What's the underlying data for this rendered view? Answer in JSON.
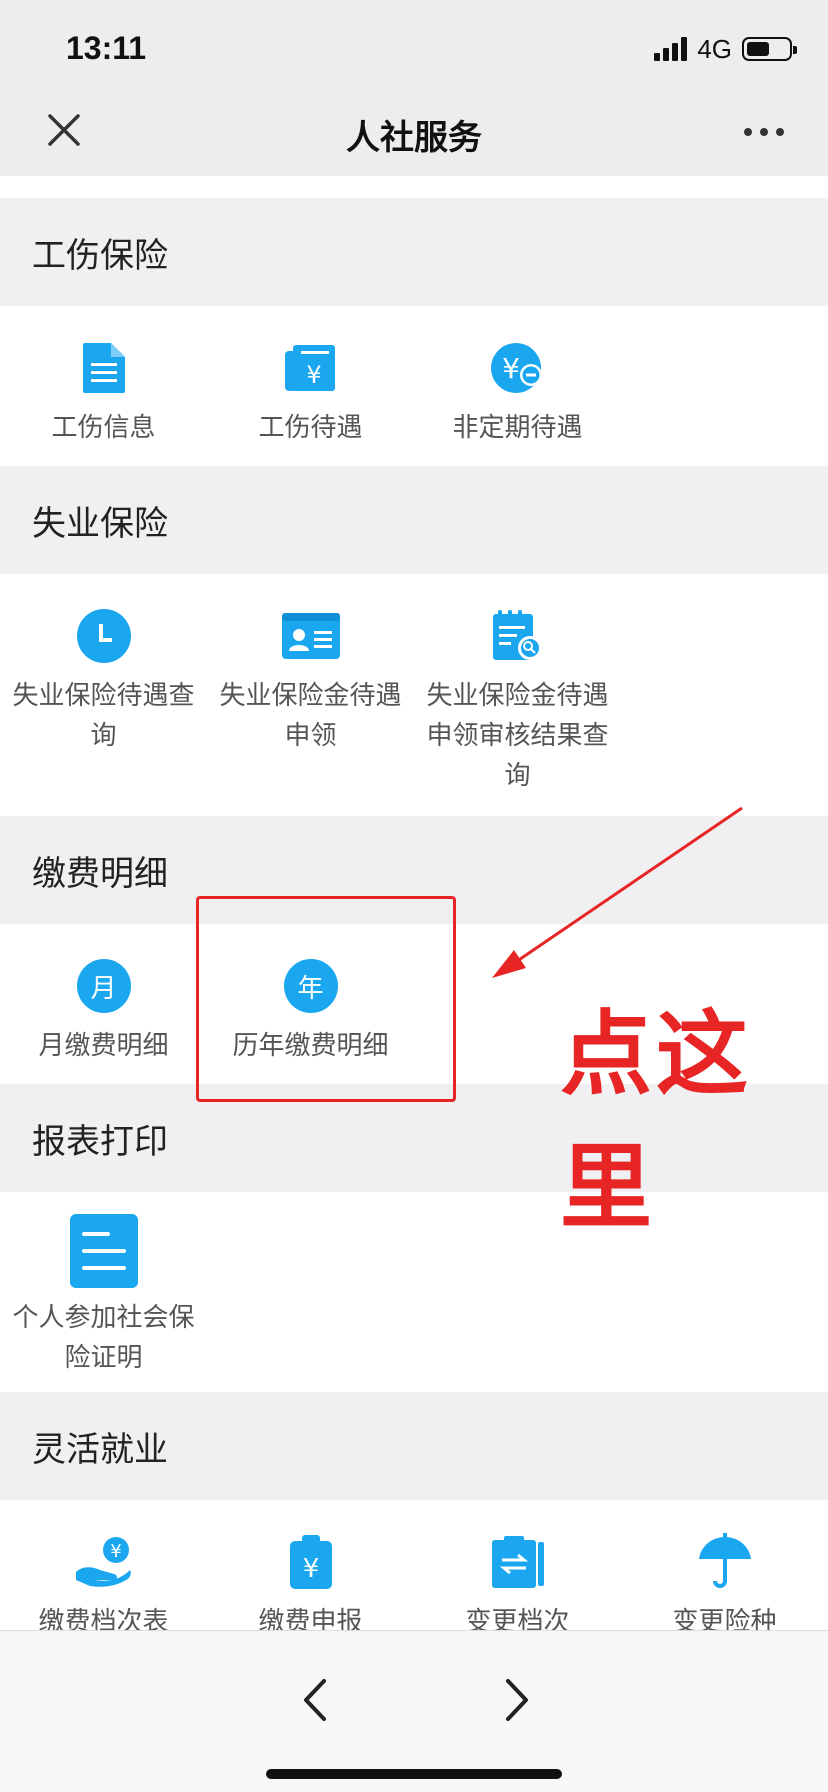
{
  "status_bar": {
    "time": "13:11",
    "network": "4G"
  },
  "nav": {
    "title": "人社服务"
  },
  "sections": {
    "injury": {
      "title": "工伤保险",
      "items": [
        "工伤信息",
        "工伤待遇",
        "非定期待遇"
      ]
    },
    "unemployment": {
      "title": "失业保险",
      "items": [
        "失业保险待遇查询",
        "失业保险金待遇申领",
        "失业保险金待遇申领审核结果查询"
      ]
    },
    "payment": {
      "title": "缴费明细",
      "items": [
        "月缴费明细",
        "历年缴费明细"
      ],
      "icon_text": [
        "月",
        "年"
      ]
    },
    "report": {
      "title": "报表打印",
      "items": [
        "个人参加社会保险证明"
      ]
    },
    "flexible": {
      "title": "灵活就业",
      "items": [
        "缴费档次表",
        "缴费申报",
        "变更档次",
        "变更险种"
      ]
    }
  },
  "annotation": {
    "text": "点这里"
  },
  "colors": {
    "accent": "#1aa7f0",
    "annotation": "#e82525"
  }
}
